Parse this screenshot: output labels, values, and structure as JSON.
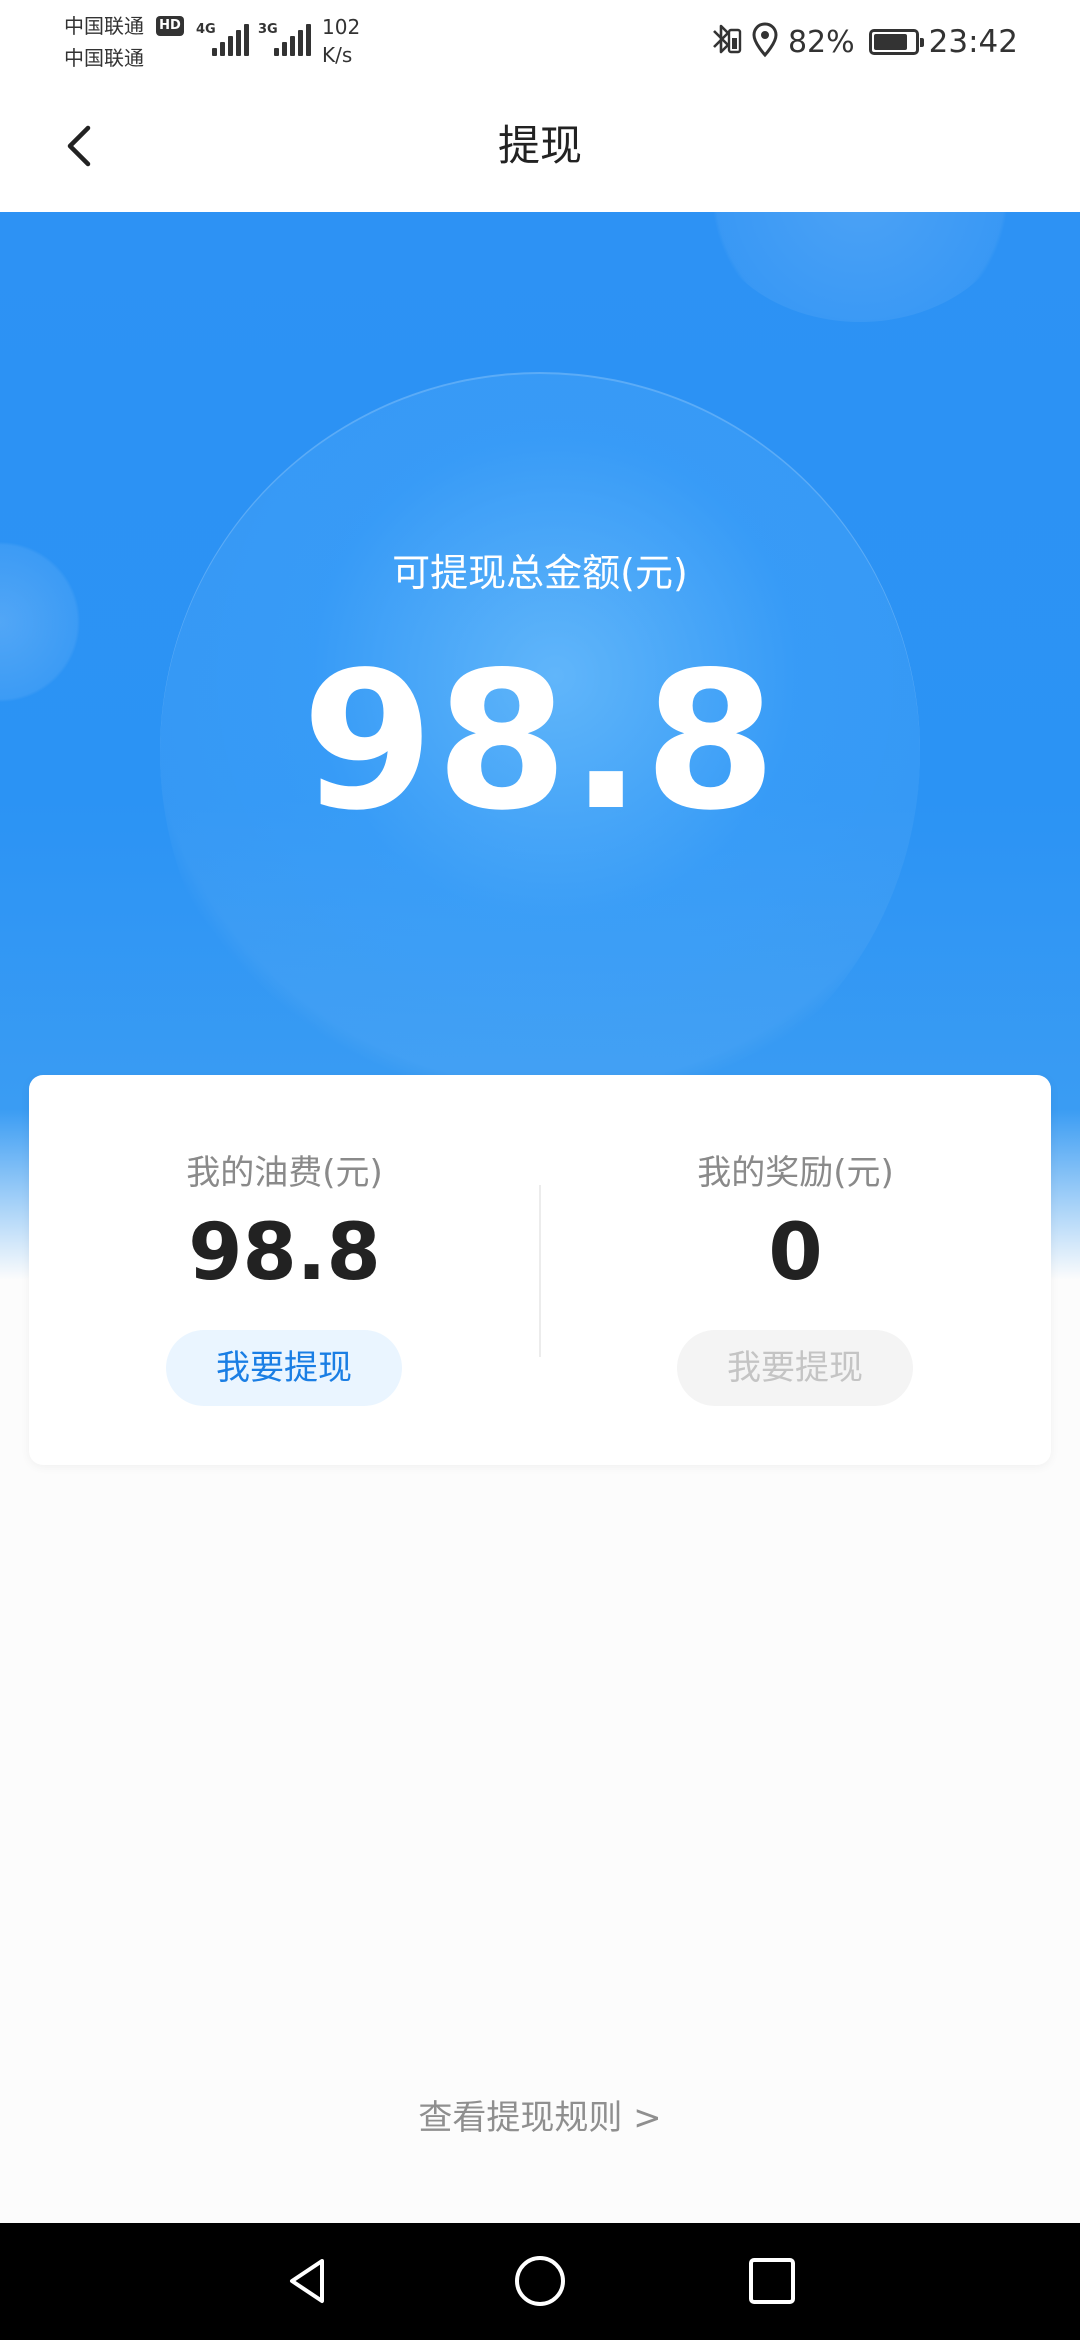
{
  "status_bar": {
    "carrier1": "中国联通",
    "carrier2": "中国联通",
    "hd": "HD",
    "net1": "4G",
    "net2": "3G",
    "net_speed_value": "102",
    "net_speed_unit": "K/s",
    "battery_percent": "82%",
    "battery_level": 0.82,
    "time": "23:42",
    "icons": [
      "bluetooth-icon",
      "location-icon",
      "battery-icon"
    ]
  },
  "header": {
    "title": "提现",
    "back_icon": "chevron-left-icon"
  },
  "hero": {
    "label": "可提现总金额(元)",
    "amount": "98.8"
  },
  "card": {
    "fuel": {
      "label": "我的油费(元)",
      "amount": "98.8",
      "button": "我要提现",
      "enabled": true
    },
    "reward": {
      "label": "我的奖励(元)",
      "amount": "0",
      "button": "我要提现",
      "enabled": false
    }
  },
  "footer": {
    "rules_link": "查看提现规则 >"
  },
  "nav_bar": {
    "items": [
      "back-triangle-icon",
      "home-circle-icon",
      "recents-square-icon"
    ]
  },
  "colors": {
    "primary_blue": "#2b93f4",
    "link_blue": "#1a7ee4",
    "disabled_text": "#c4c4c4"
  }
}
